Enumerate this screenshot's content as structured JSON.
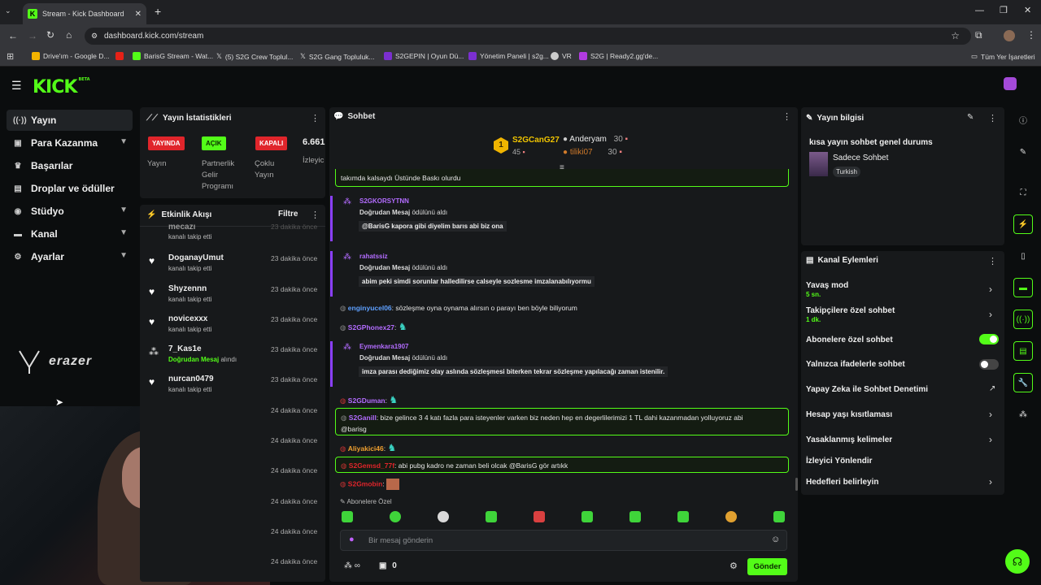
{
  "browser": {
    "tab_title": "Stream - Kick Dashboard",
    "url": "dashboard.kick.com/stream",
    "bookmarks": [
      "Drive'ım - Google D...",
      "BarisG Stream - Wat...",
      "(5) S2G Crew Toplul...",
      "S2G Gang Topluluk...",
      "S2GEPIN | Oyun Dü...",
      "Yönetim Paneli | s2g...",
      "VR",
      "S2G | Ready2.gg'de..."
    ],
    "all_bookmarks": "Tüm Yer İşaretleri"
  },
  "brand": {
    "logo": "KICK",
    "beta": "BETA",
    "sponsor": "erazer"
  },
  "sidebar": {
    "items": [
      {
        "label": "Yayın",
        "icon": "broadcast-icon"
      },
      {
        "label": "Para Kazanma",
        "icon": "wallet-icon"
      },
      {
        "label": "Başarılar",
        "icon": "trophy-icon"
      },
      {
        "label": "Droplar ve ödüller",
        "icon": "gift-icon"
      },
      {
        "label": "Stüdyo",
        "icon": "studio-icon"
      },
      {
        "label": "Kanal",
        "icon": "channel-icon"
      },
      {
        "label": "Ayarlar",
        "icon": "gear-icon"
      }
    ]
  },
  "stats": {
    "title": "Yayın İstatistikleri",
    "live_badge": "YAYINDA",
    "live_label": "Yayın",
    "partner_badge": "AÇIK",
    "partner_label": "Partnerlik Gelir Programı",
    "multi_badge": "KAPALI",
    "multi_label": "Çoklu Yayın",
    "viewers_value": "6.661",
    "viewers_label": "İzleyic"
  },
  "activity": {
    "title": "Etkinlik Akışı",
    "filter": "Filtre",
    "events": [
      {
        "name": "mecazi",
        "sub": "kanalı takip etti",
        "time": "23 dakika önce"
      },
      {
        "name": "DoganayUmut",
        "sub": "kanalı takip etti",
        "time": "23 dakika önce"
      },
      {
        "name": "Shyzennn",
        "sub": "kanalı takip etti",
        "time": "23 dakika önce"
      },
      {
        "name": "novicexxx",
        "sub": "kanalı takip etti",
        "time": "23 dakika önce"
      },
      {
        "name": "7_Kas1e",
        "sub": "Doğrudan Mesaj",
        "sub2": "alındı",
        "time": "23 dakika önce"
      },
      {
        "name": "nurcan0479",
        "sub": "kanalı takip etti",
        "time": "23 dakika önce"
      }
    ],
    "more_times": [
      "24 dakika önce",
      "24 dakika önce",
      "24 dakika önce",
      "24 dakika önce",
      "24 dakika önce",
      "24 dakika önce"
    ]
  },
  "chat": {
    "title": "Sohbet",
    "top": [
      {
        "name": "S2GCanG27",
        "count": "45"
      },
      {
        "name": "Anderyam",
        "count": "30"
      },
      {
        "name": "tiliki07",
        "count": "30"
      }
    ],
    "rank_one": "1",
    "pinned_text": "takımda kalsaydı Üstünde Baskı olurdu",
    "rewards": [
      {
        "user": "S2GKORSYTNN",
        "action": "Doğrudan Mesaj",
        "action_suffix": "ödülünü aldı",
        "quote": "@BarisG kapora gibi diyelim barıs abi biz ona"
      },
      {
        "user": "rahatssiz",
        "action": "Doğrudan Mesaj",
        "action_suffix": "ödülünü aldı",
        "quote": "abim peki simdi sorunlar halledilirse calseyle sozlesme imzalanabılıyormu"
      },
      {
        "user": "Eymenkara1907",
        "action": "Doğrudan Mesaj",
        "action_suffix": "ödülünü aldı",
        "quote": "imza parası dediğimiz olay aslında sözleşmesi biterken tekrar sözleşme yapılacağı zaman istenilir."
      }
    ],
    "messages": [
      {
        "user": "enginyucel06",
        "text": ": sözleşme oyna oynama alırsın o parayı ben böyle biliyorum"
      },
      {
        "user": "S2GPhonex27",
        "text": ":"
      },
      {
        "user": "S2GDuman",
        "text": ":"
      },
      {
        "user": "S2Ganill",
        "text": ": bize gelince 3 4 katı fazla para isteyenler varken biz neden hep en degerlilerimizi 1 TL dahi kazanmadan yolluyoruz abi",
        "text2": "@barisg"
      },
      {
        "user": "Aliyakici46",
        "text": ":"
      },
      {
        "user": "S2Gemsd_77f",
        "text": ": abi pubg kadro ne zaman beli olcak @BarisG gör artıkk"
      },
      {
        "user": "S2Gmobin",
        "text": ":"
      }
    ],
    "subs_only": "Abonelere Özel",
    "input_placeholder": "Bir mesaj gönderin",
    "points": "0",
    "send": "Gönder"
  },
  "stream_info": {
    "title": "Yayın bilgisi",
    "stream_title": "kısa yayın sohbet genel durums",
    "category": "Sadece Sohbet",
    "tag": "Turkish"
  },
  "channel_actions": {
    "title": "Kanal Eylemleri",
    "items": [
      {
        "label": "Yavaş mod",
        "sub": "5 sn."
      },
      {
        "label": "Takipçilere özel sohbet",
        "sub": "1 dk."
      },
      {
        "label": "Abonelere özel sohbet",
        "toggle": true
      },
      {
        "label": "Yalnızca ifadelerle sohbet",
        "toggle": false
      },
      {
        "label": "Yapay Zeka ile Sohbet Denetimi"
      },
      {
        "label": "Hesap yaşı kısıtlaması"
      },
      {
        "label": "Yasaklanmış kelimeler"
      },
      {
        "label": "İzleyici Yönlendir"
      },
      {
        "label": "Hedefleri belirleyin"
      }
    ]
  },
  "colors": {
    "accent": "#53fc18",
    "red": "#e0252b",
    "purple": "#8a3ffc"
  }
}
